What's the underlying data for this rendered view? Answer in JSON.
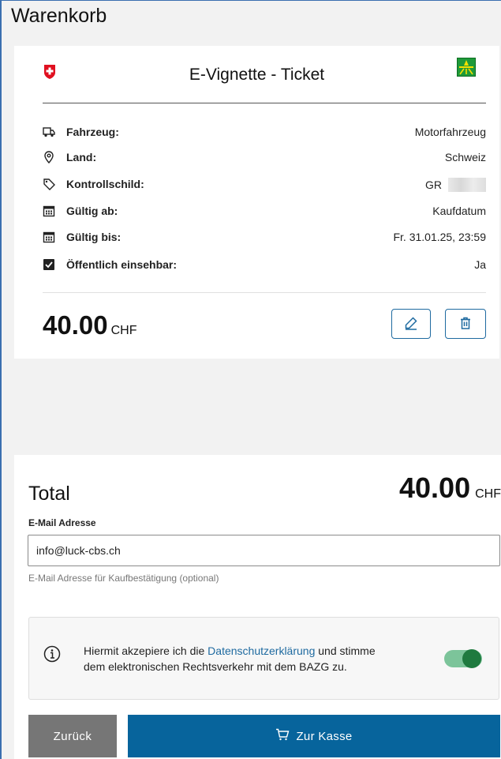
{
  "page": {
    "title": "Warenkorb"
  },
  "card": {
    "title": "E-Vignette - Ticket",
    "rows": [
      {
        "icon": "vehicle-icon",
        "label": "Fahrzeug:",
        "value": "Motorfahrzeug"
      },
      {
        "icon": "location-pin-icon",
        "label": "Land:",
        "value": "Schweiz"
      },
      {
        "icon": "tag-icon",
        "label": "Kontrollschild:",
        "value": "GR"
      },
      {
        "icon": "calendar-icon",
        "label": "Gültig ab:",
        "value": "Kaufdatum"
      },
      {
        "icon": "calendar-icon",
        "label": "Gültig bis:",
        "value": "Fr. 31.01.25, 23:59"
      },
      {
        "icon": "checkbox-checked-icon",
        "label": "Öffentlich einsehbar:",
        "value": "Ja"
      }
    ],
    "price": {
      "amount": "40.00",
      "currency": "CHF"
    }
  },
  "summary": {
    "total_label": "Total",
    "total_amount": "40.00",
    "total_currency": "CHF"
  },
  "email": {
    "label": "E-Mail Adresse",
    "value": "info@luck-cbs.ch",
    "hint": "E-Mail Adresse für Kaufbestätigung (optional)"
  },
  "consent": {
    "text_before": "Hiermit akzepiere ich die ",
    "link": "Datenschutzerklärung",
    "text_after": " und stimme dem elektronischen Rechtsverkehr mit dem BAZG zu.",
    "toggle_on": true
  },
  "buttons": {
    "back": "Zurück",
    "checkout": "Zur Kasse"
  },
  "colors": {
    "primary": "#07649c",
    "toggle": "#1f7a3f",
    "swiss_red": "#e01020",
    "road_green": "#1f9a3a"
  }
}
